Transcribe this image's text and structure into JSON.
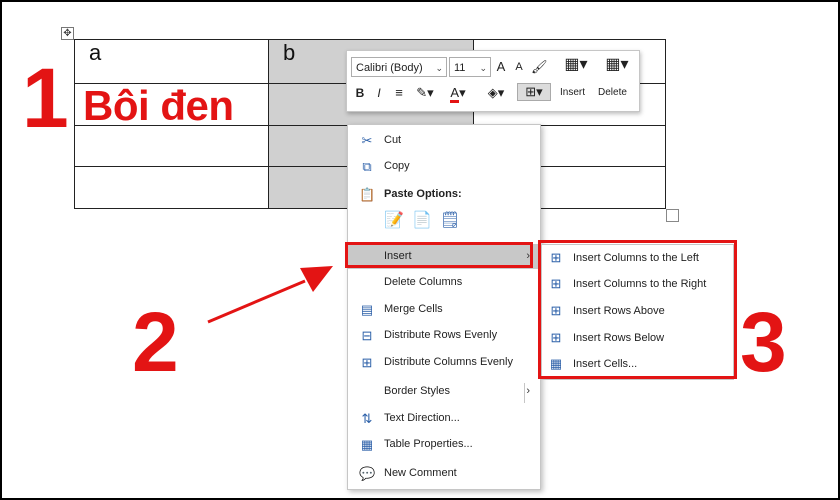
{
  "table": {
    "rows": [
      [
        "a",
        "b",
        ""
      ],
      [
        "",
        "",
        ""
      ],
      [
        "",
        "",
        ""
      ],
      [
        "",
        "",
        ""
      ]
    ]
  },
  "annotations": {
    "step1_number": "1",
    "step1_text": "Bôi đen",
    "step2_number": "2",
    "step3_number": "3",
    "accent_color": "#e31414"
  },
  "mini_toolbar": {
    "font_name": "Calibri (Body)",
    "font_size": "11",
    "grow_font": "A",
    "shrink_font": "A",
    "bold": "B",
    "italic": "I",
    "font_color": "A",
    "insert_label": "Insert",
    "delete_label": "Delete"
  },
  "context_menu": {
    "cut": "Cut",
    "copy": "Copy",
    "paste_options": "Paste Options:",
    "insert": "Insert",
    "delete_columns": "Delete Columns",
    "merge_cells": "Merge Cells",
    "distribute_rows": "Distribute Rows Evenly",
    "distribute_columns": "Distribute Columns Evenly",
    "border_styles": "Border Styles",
    "text_direction": "Text Direction...",
    "table_properties": "Table Properties...",
    "new_comment": "New Comment"
  },
  "insert_submenu": {
    "items": [
      "Insert Columns to the Left",
      "Insert Columns to the Right",
      "Insert Rows Above",
      "Insert Rows Below",
      "Insert Cells..."
    ]
  }
}
